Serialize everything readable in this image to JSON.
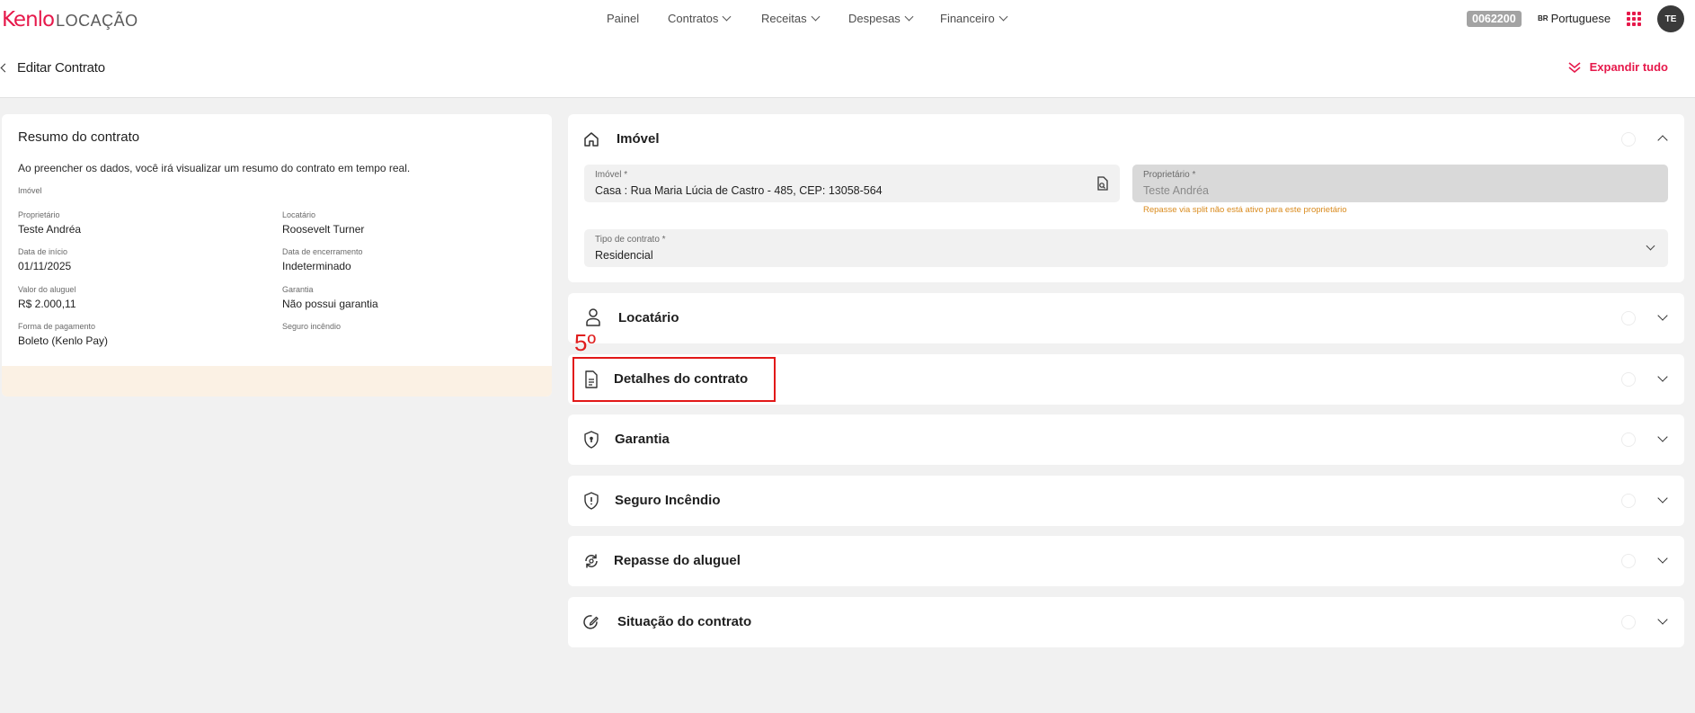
{
  "header": {
    "brand": "Kenlo",
    "product": "LOCAÇÃO",
    "nav": [
      {
        "label": "Painel",
        "dropdown": false
      },
      {
        "label": "Contratos",
        "dropdown": true
      },
      {
        "label": "Receitas",
        "dropdown": true
      },
      {
        "label": "Despesas",
        "dropdown": true
      },
      {
        "label": "Financeiro",
        "dropdown": true
      }
    ],
    "account_code": "0062200",
    "language_flag": "BR",
    "language": "Portuguese",
    "avatar_initials": "TE"
  },
  "page": {
    "title": "Editar Contrato",
    "expand_all": "Expandir tudo"
  },
  "summary": {
    "title": "Resumo do contrato",
    "intro": "Ao preencher os dados, você irá visualizar um resumo do contrato em tempo real.",
    "imovel_label": "Imóvel",
    "fields": [
      {
        "label": "Proprietário",
        "value": "Teste Andréa"
      },
      {
        "label": "Locatário",
        "value": "Roosevelt Turner"
      },
      {
        "label": "Data de início",
        "value": "01/11/2025"
      },
      {
        "label": "Data de encerramento",
        "value": "Indeterminado"
      },
      {
        "label": "Valor do aluguel",
        "value": "R$ 2.000,11"
      },
      {
        "label": "Garantia",
        "value": "Não possui garantia"
      },
      {
        "label": "Forma de pagamento",
        "value": "Boleto (Kenlo Pay)"
      },
      {
        "label": "Seguro incêndio",
        "value": ""
      }
    ]
  },
  "sections": {
    "imovel": {
      "title": "Imóvel",
      "icon": "home-icon",
      "fields": {
        "imovel_label": "Imóvel *",
        "imovel_value": "Casa : Rua Maria Lúcia de Castro - 485, CEP: 13058-564",
        "proprietario_label": "Proprietário *",
        "proprietario_value": "Teste Andréa",
        "proprietario_hint": "Repasse via split não está ativo para este proprietário",
        "tipo_label": "Tipo de contrato *",
        "tipo_value": "Residencial"
      }
    },
    "locatario": {
      "title": "Locatário",
      "icon": "user-icon"
    },
    "detalhes": {
      "title": "Detalhes do contrato",
      "icon": "document-icon"
    },
    "garantia": {
      "title": "Garantia",
      "icon": "shield-lock-icon"
    },
    "seguro": {
      "title": "Seguro Incêndio",
      "icon": "shield-alert-icon"
    },
    "repasse": {
      "title": "Repasse do aluguel",
      "icon": "transfer-icon"
    },
    "situacao": {
      "title": "Situação do contrato",
      "icon": "edit-circle-icon"
    }
  },
  "annotation": {
    "step": "5º",
    "color": "#e21818"
  },
  "colors": {
    "brand": "#e6194b",
    "warning": "#d98a1c",
    "summary_footer": "#fbf1e4"
  }
}
